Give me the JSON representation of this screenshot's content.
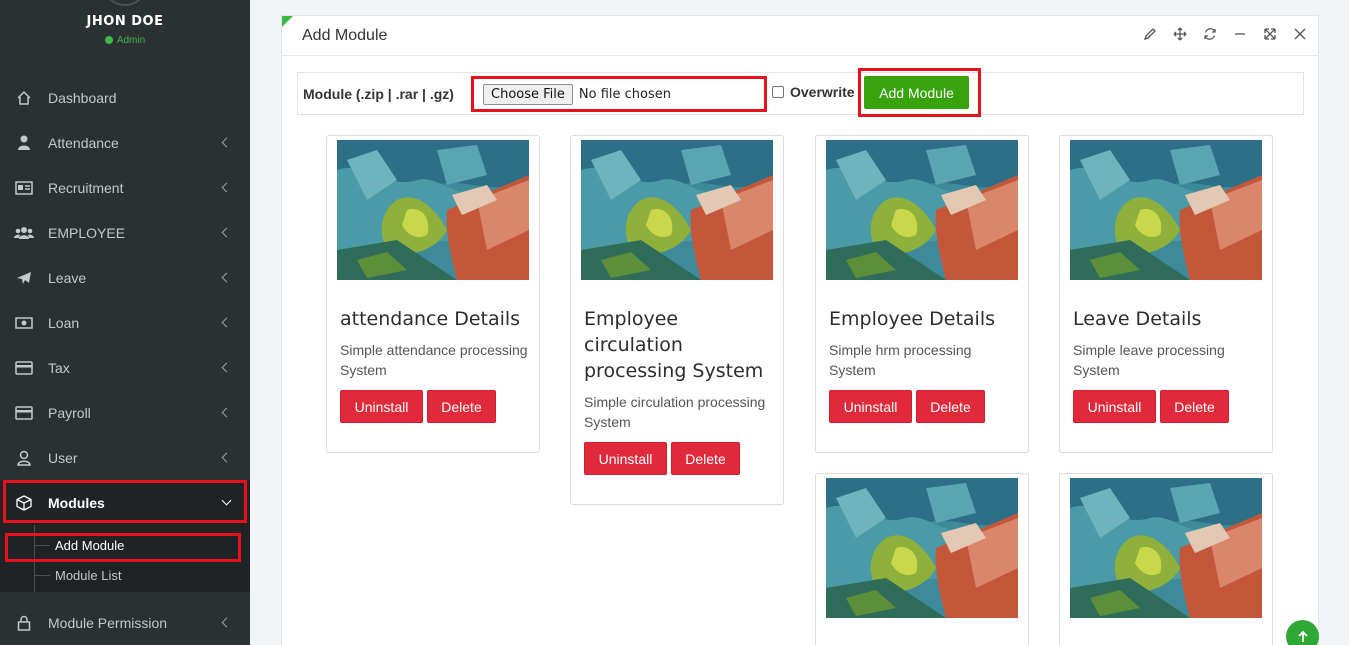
{
  "user": {
    "name": "JHON DOE",
    "role": "Admin"
  },
  "sidebar": {
    "items": [
      {
        "label": "Dashboard",
        "icon": "home-icon"
      },
      {
        "label": "Attendance",
        "icon": "user-icon"
      },
      {
        "label": "Recruitment",
        "icon": "id-card-icon"
      },
      {
        "label": "EMPLOYEE",
        "icon": "users-icon"
      },
      {
        "label": "Leave",
        "icon": "plane-icon"
      },
      {
        "label": "Loan",
        "icon": "money-icon"
      },
      {
        "label": "Tax",
        "icon": "card-icon"
      },
      {
        "label": "Payroll",
        "icon": "card-icon"
      },
      {
        "label": "User",
        "icon": "person-outline-icon"
      },
      {
        "label": "Modules",
        "icon": "cube-icon"
      }
    ],
    "modules_sub": [
      {
        "label": "Add Module"
      },
      {
        "label": "Module List"
      }
    ],
    "permission": {
      "label": "Module Permission",
      "icon": "lock-icon"
    }
  },
  "panel": {
    "title": "Add Module",
    "upload_label": "Module (.zip | .rar | .gz)",
    "file_button": "Choose File",
    "file_status": "No file chosen",
    "overwrite_label": "Overwrite",
    "add_button": "Add Module"
  },
  "cards": [
    {
      "title": "attendance Details",
      "desc": "Simple attendance processing System",
      "uninstall": "Uninstall",
      "delete": "Delete"
    },
    {
      "title": "Employee circulation processing System",
      "desc": "Simple circulation processing System",
      "uninstall": "Uninstall",
      "delete": "Delete"
    },
    {
      "title": "Employee Details",
      "desc": "Simple hrm processing System",
      "uninstall": "Uninstall",
      "delete": "Delete"
    },
    {
      "title": "Leave Details",
      "desc": "Simple leave processing System",
      "uninstall": "Uninstall",
      "delete": "Delete"
    }
  ],
  "colors": {
    "accent_green": "#37a40e",
    "danger": "#e0293a",
    "highlight": "#e8101b",
    "sidebar": "#2b3033"
  }
}
